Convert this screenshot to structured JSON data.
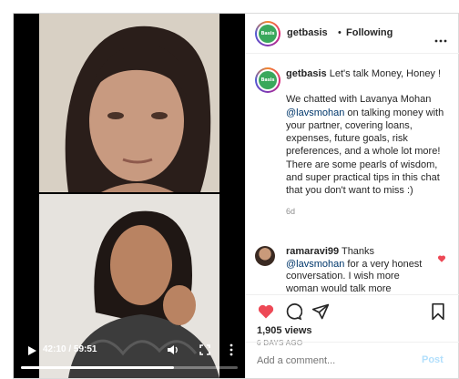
{
  "post": {
    "username": "getbasis",
    "follow_status": "Following",
    "avatar_text": "Basis",
    "more_icon": "more-horizontal-icon"
  },
  "caption": {
    "username": "getbasis",
    "intro": "Let's talk Money, Honey !",
    "body_pre": "We chatted with Lavanya Mohan ",
    "mention": "@lavsmohan",
    "body_post": " on talking money with your partner, covering loans, expenses, future goals, risk preferences, and a whole lot more! There are some pearls of wisdom, and super practical tips in this chat that you don't want to miss :)",
    "age": "6d"
  },
  "comments": [
    {
      "username": "ramaravi99",
      "pre": "Thanks ",
      "mention": "@lavsmohan",
      "post": " for a very honest conversation. I wish more woman would talk more"
    }
  ],
  "video": {
    "time_current": "42:10",
    "time_total": "59:51",
    "time_display": "42:10 / 59:51",
    "progress": 0.705
  },
  "stats": {
    "views": "1,905 views",
    "posted_ago": "6 DAYS AGO"
  },
  "add_comment": {
    "placeholder": "Add a comment...",
    "post_label": "Post"
  },
  "colors": {
    "accent_link": "#00376b",
    "like_red": "#ed4956",
    "post_button": "#b2dffc",
    "brand_green": "#3aa85c"
  }
}
